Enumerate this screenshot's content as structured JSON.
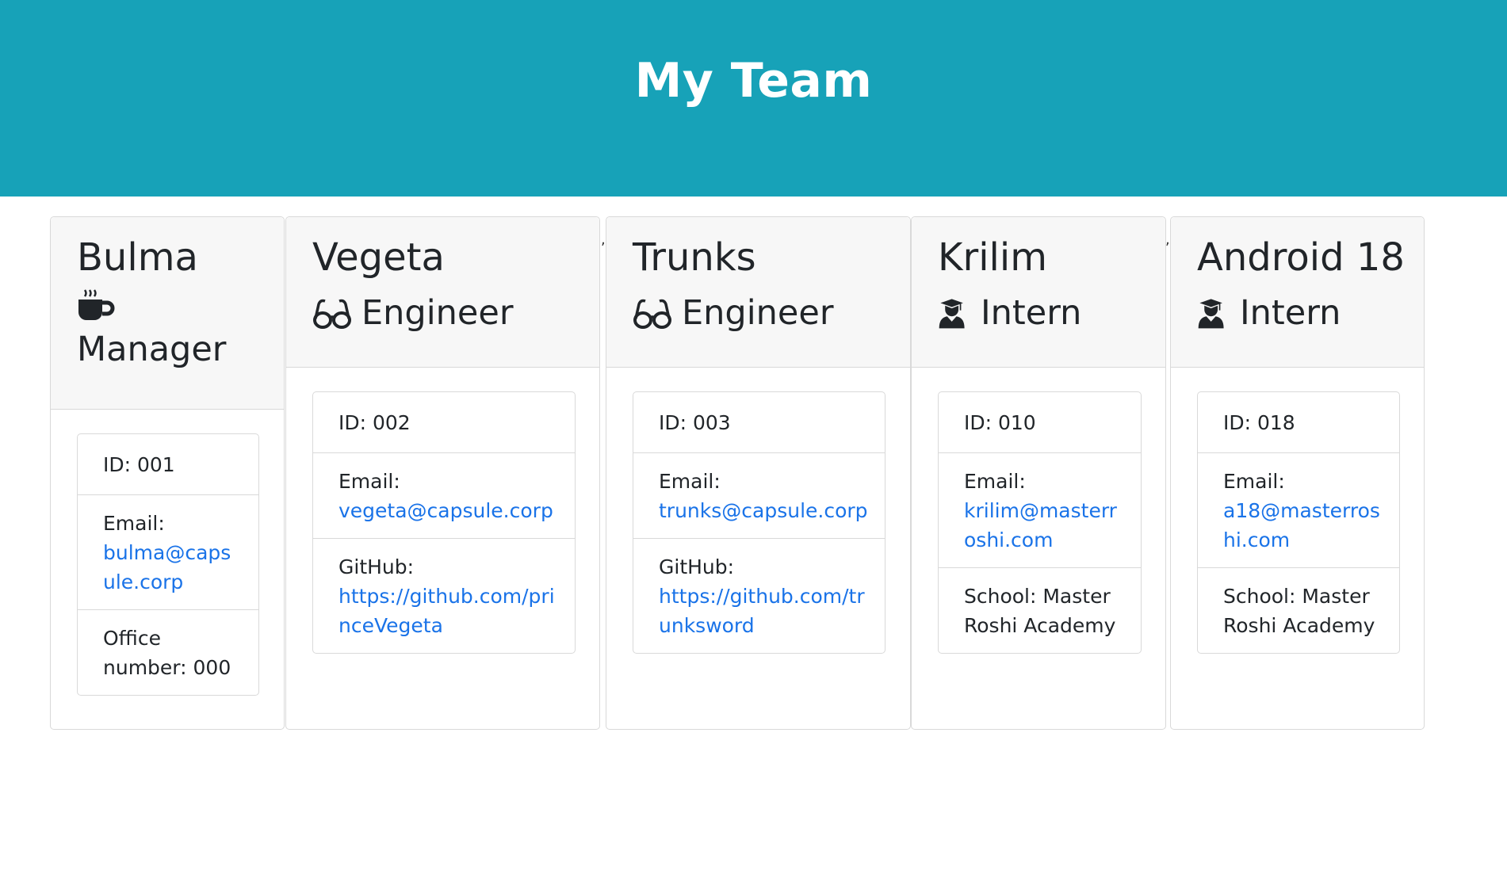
{
  "header": {
    "title": "My Team",
    "background": "#17a2b8"
  },
  "cards": [
    {
      "name": "Bulma",
      "role": "Manager",
      "icon": "coffee-icon",
      "id": "ID: 001",
      "email_label": "Email:",
      "email": "bulma@capsule.corp",
      "extra": "Office number: 000"
    },
    {
      "name": "Vegeta",
      "role": "Engineer",
      "icon": "glasses-icon",
      "id": "ID: 002",
      "email_label": "Email:",
      "email": "vegeta@capsule.corp",
      "extra_label": "GitHub:",
      "extra_link": "https://github.com/princeVegeta"
    },
    {
      "name": "Trunks",
      "role": "Engineer",
      "icon": "glasses-icon",
      "id": "ID: 003",
      "email_label": "Email:",
      "email": "trunks@capsule.corp",
      "extra_label": "GitHub:",
      "extra_link": "https://github.com/trunksword"
    },
    {
      "name": "Krilim",
      "role": "Intern",
      "icon": "graduate-icon",
      "id": "ID: 010",
      "email_label": "Email:",
      "email": "krilim@masterroshi.com",
      "extra": "School: Master Roshi Academy"
    },
    {
      "name": "Android 18",
      "role": "Intern",
      "icon": "graduate-icon",
      "id": "ID: 018",
      "email_label": "Email:",
      "email": "a18@masterroshi.com",
      "extra": "School: Master Roshi Academy"
    }
  ],
  "stray_marks": [
    ",",
    ","
  ],
  "colors": {
    "link": "#1a73e8",
    "card_header_bg": "#f7f7f7",
    "border": "#d9d9d9"
  }
}
